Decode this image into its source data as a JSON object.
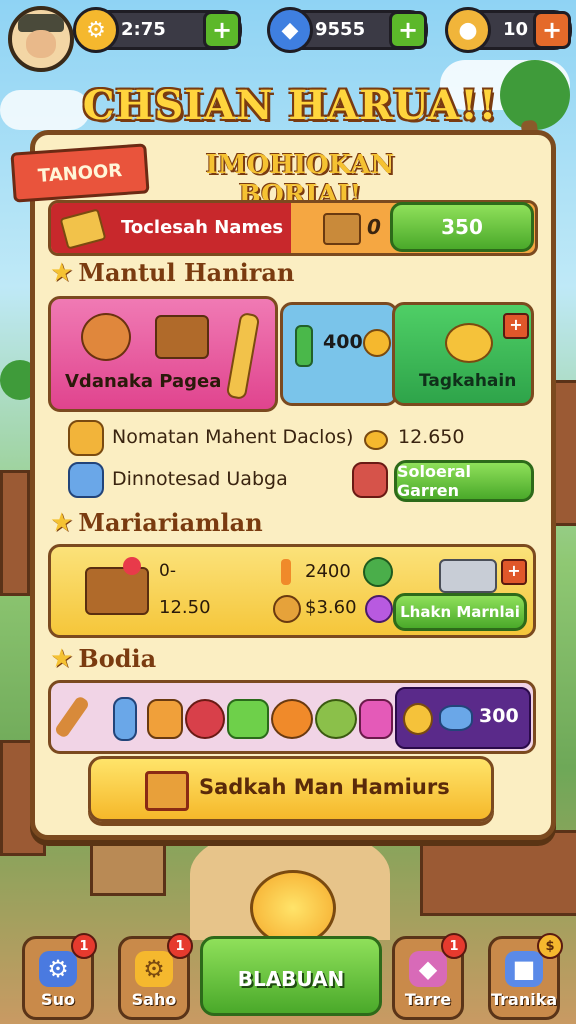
{
  "top_bar": {
    "resources": [
      {
        "icon": "gear-coin-icon",
        "value": "2:75",
        "color": "#f5b82e"
      },
      {
        "icon": "blue-gem-icon",
        "value": "9555",
        "color": "#3f7fe0"
      },
      {
        "icon": "gold-coin-icon",
        "value": "10",
        "color": "#f1b53a"
      }
    ],
    "plus": "+"
  },
  "title": "CHSIAN HARUA!!",
  "panel": {
    "ribbon": "TANOOR",
    "subtitle": "IMOHIOKAN BORIAI!",
    "row1": {
      "label": "Toclesah Names",
      "count": "0",
      "button": "350"
    },
    "section1": {
      "title": "Mantul Haniran",
      "card_pink_label": "Vdanaka Pagea",
      "card_blue_value": "400",
      "card_green_label": "Tagkahain",
      "badge_plus": "+"
    },
    "list": [
      {
        "label": "Nomatan Mahent Daclos)",
        "value": "12.650"
      },
      {
        "label": "Dinnotesad Uabga",
        "button": "Soloeral Garren"
      }
    ],
    "section2": {
      "title": "Mariariamlan",
      "small_value": "0-",
      "price": "12.50",
      "value_a": "2400",
      "value_b": "$3.60",
      "button": "Lhakn Marnlai",
      "badge": "+"
    },
    "section3": {
      "title": "Bodia",
      "value": "300"
    },
    "main_button": "Sadkah Man Hamiurs"
  },
  "nav": [
    {
      "label": "Suo",
      "badge": "1",
      "icon": "blue-gear-icon"
    },
    {
      "label": "Saho",
      "badge": "1",
      "icon": "gold-gear-icon"
    },
    {
      "label": "BLABUAN",
      "icon": "mascot-icon"
    },
    {
      "label": "Tarre",
      "badge": "1",
      "icon": "pink-bag-icon"
    },
    {
      "label": "Tranika",
      "badge": "$",
      "icon": "blue-dice-icon"
    }
  ]
}
